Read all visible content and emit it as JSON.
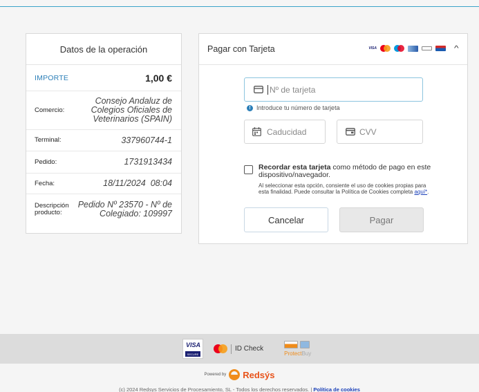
{
  "operation": {
    "title": "Datos de la operación",
    "amount_label": "IMPORTE",
    "amount_value": "1,00 €",
    "rows": [
      {
        "label": "Comercio:",
        "value": "Consejo Andaluz de Colegios Oficiales de Veterinarios (SPAIN)"
      },
      {
        "label": "Terminal:",
        "value": "337960744-1"
      },
      {
        "label": "Pedido:",
        "value": "1731913434"
      },
      {
        "label": "Fecha:",
        "value": "18/11/2024  08:04"
      },
      {
        "label": "Descripción producto:",
        "value": "Pedido Nº 23570 - Nº de Colegiado: 109997"
      }
    ]
  },
  "payment": {
    "title": "Pagar con Tarjeta",
    "brand_icons": [
      "visa-icon",
      "mastercard-icon",
      "maestro-icon",
      "jcb-icon",
      "diners-icon",
      "amex-icon"
    ],
    "card_number_placeholder": "Nº de tarjeta",
    "card_hint": "Introduce tu número de tarjeta",
    "expiry_placeholder": "Caducidad",
    "cvv_placeholder": "CVV",
    "remember_bold": "Recordar esta tarjeta",
    "remember_rest": " como método de pago en este dispositivo/navegador.",
    "cookies_text": "Al seleccionar esta opción, consiente el uso de cookies propias para esta finalidad. Puede consultar la Política de Cookies completa ",
    "cookies_link": "aquí*",
    "cookies_end": ".",
    "cancel_label": "Cancelar",
    "pay_label": "Pagar"
  },
  "footer": {
    "visa_text": "VISA",
    "visa_secure": "SECURE",
    "idcheck_text": "ID Check",
    "protectbuy_a": "Protect",
    "protectbuy_b": "Buy",
    "powered_by": "Powered by",
    "brand": "Redsýs",
    "copyright": "(c) 2024 Redsys Servicios de Procesamiento, SL - Todos los derechos reservados. | ",
    "cookies_policy": "Política de cookies"
  },
  "colors": {
    "accent": "#2c7fb8",
    "redsys_orange": "#f08c1a",
    "redsys_red": "#e8531a",
    "topline": "#3aa3c9"
  }
}
